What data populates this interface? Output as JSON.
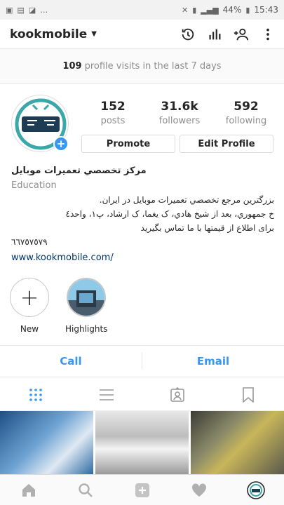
{
  "status_bar": {
    "time": "15:43",
    "battery": "44%"
  },
  "header": {
    "username": "kookmobile"
  },
  "visits": {
    "count": "109",
    "text": "profile visits in the last 7 days"
  },
  "stats": [
    {
      "value": "152",
      "label": "posts"
    },
    {
      "value": "31.6k",
      "label": "followers"
    },
    {
      "value": "592",
      "label": "following"
    }
  ],
  "buttons": {
    "promote": "Promote",
    "edit_profile": "Edit Profile"
  },
  "bio": {
    "name": "مرکز تخصصي تعميرات موبايل",
    "category": "Education",
    "lines": [
      "بزرگترين مرجع تخصصي تعميرات موبايل در ايران.",
      "خ جمهوري، بعد از شيخ هادي، ک يغما، ک ارشاد، پ١، واحد٤",
      "براى اطلاع از قيمتها با ما تماس بگيريد",
      "٦٦٧٥٧٥٧٩"
    ],
    "link": "www.kookmobile.com/"
  },
  "highlights": {
    "new_label": "New",
    "highlights_label": "Highlights"
  },
  "contact": {
    "call": "Call",
    "email": "Email"
  },
  "colors": {
    "accent": "#3897f0",
    "text": "#262626",
    "muted": "#8e8e8e"
  }
}
